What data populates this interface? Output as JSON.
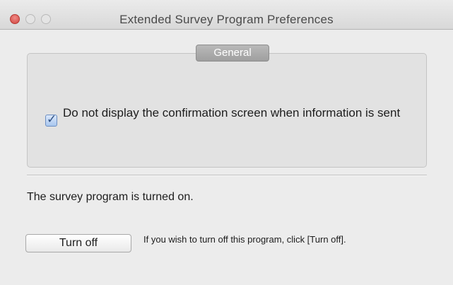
{
  "window": {
    "title": "Extended Survey Program Preferences",
    "accent_close": "#d0453f"
  },
  "general": {
    "tab_label": "General",
    "checkbox_label": "Do not display the confirmation screen when information is sent",
    "checkbox_checked": true
  },
  "status": {
    "text": "The survey program is turned on."
  },
  "action": {
    "button_label": "Turn off",
    "hint": "If you wish to turn off this program, click [Turn off]."
  }
}
